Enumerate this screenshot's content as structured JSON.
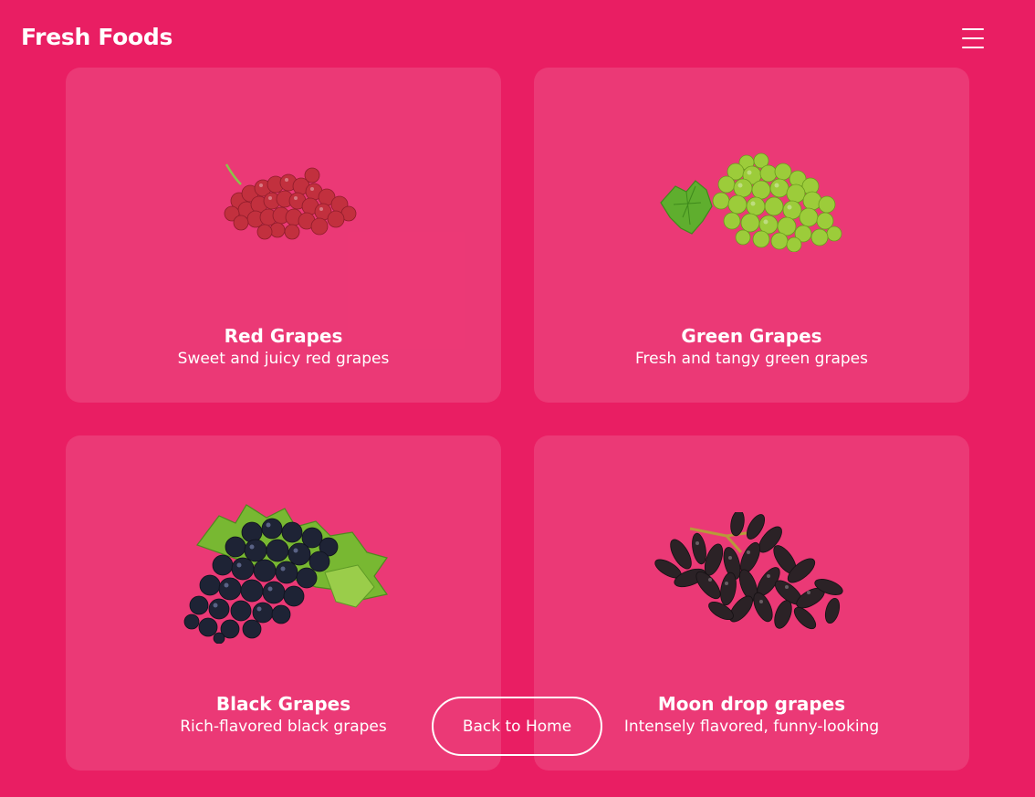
{
  "header": {
    "brand": "Fresh Foods",
    "menu_icon": "hamburger-menu-icon"
  },
  "products": [
    {
      "title": "Red Grapes",
      "description": "Sweet and juicy red grapes",
      "image": "red-grapes-image"
    },
    {
      "title": "Green Grapes",
      "description": "Fresh and tangy green grapes",
      "image": "green-grapes-image"
    },
    {
      "title": "Black Grapes",
      "description": "Rich-flavored black grapes",
      "image": "black-grapes-image"
    },
    {
      "title": "Moon drop grapes",
      "description": "Intensely flavored, funny-looking",
      "image": "moon-drop-grapes-image"
    }
  ],
  "footer": {
    "back_label": "Back to Home"
  },
  "colors": {
    "background": "#e91e63",
    "card": "rgba(255,255,255,0.12)",
    "text": "#ffffff"
  }
}
